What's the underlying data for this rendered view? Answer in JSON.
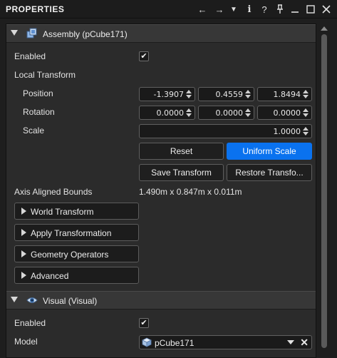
{
  "window": {
    "title": "PROPERTIES",
    "toolbar": [
      {
        "name": "back-arrow-icon",
        "glyph": "←"
      },
      {
        "name": "forward-arrow-icon",
        "glyph": "→"
      },
      {
        "name": "dropdown-menu-icon",
        "glyph": "▼"
      },
      {
        "name": "info-icon",
        "glyph": "i"
      },
      {
        "name": "help-icon",
        "glyph": "?"
      },
      {
        "name": "pin-icon",
        "glyph": "⊥"
      },
      {
        "name": "minimize-icon",
        "glyph": "—"
      },
      {
        "name": "maximize-icon",
        "glyph": "☐"
      },
      {
        "name": "close-icon",
        "glyph": "✕"
      }
    ]
  },
  "assembly": {
    "header": "Assembly (pCube171)",
    "enabled_label": "Enabled",
    "enabled_checked": "✔",
    "local_transform_label": "Local Transform",
    "position_label": "Position",
    "position": [
      "-1.3907",
      "0.4559",
      "1.8494"
    ],
    "rotation_label": "Rotation",
    "rotation": [
      "0.0000",
      "0.0000",
      "0.0000"
    ],
    "scale_label": "Scale",
    "scale": "1.0000",
    "reset_label": "Reset",
    "uniform_scale_label": "Uniform Scale",
    "save_transform_label": "Save Transform",
    "restore_transform_label": "Restore Transfo...",
    "bounds_label": "Axis Aligned Bounds",
    "bounds_value": "1.490m x 0.847m x 0.011m",
    "collapsers": [
      "World Transform",
      "Apply Transformation",
      "Geometry Operators",
      "Advanced"
    ]
  },
  "visual": {
    "header": "Visual (Visual)",
    "enabled_label": "Enabled",
    "enabled_checked": "✔",
    "model_label": "Model",
    "model_value": "pCube171",
    "clear_glyph": "✕"
  },
  "colors": {
    "accent": "#0a72ef",
    "panel_bg": "#2b2b2b",
    "header_bg": "#373737"
  }
}
